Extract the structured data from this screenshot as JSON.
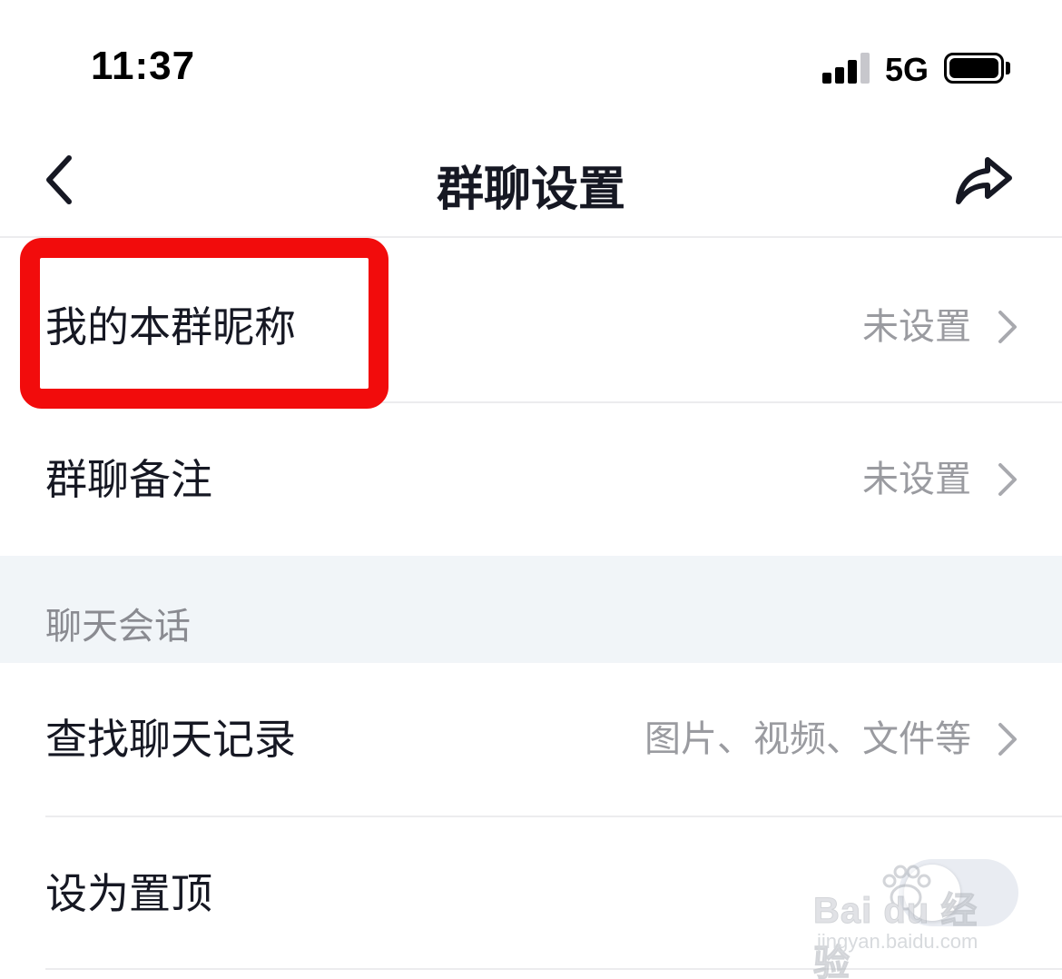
{
  "status_bar": {
    "time": "11:37",
    "network": "5G"
  },
  "nav": {
    "title": "群聊设置",
    "back_icon": "chevron-left-icon",
    "share_icon": "share-forward-icon"
  },
  "rows": {
    "group_nickname": {
      "label": "我的本群昵称",
      "value": "未设置"
    },
    "group_remark": {
      "label": "群聊备注",
      "value": "未设置"
    }
  },
  "section_chat": {
    "title": "聊天会话",
    "search_history": {
      "label": "查找聊天记录",
      "value": "图片、视频、文件等"
    },
    "pin_top": {
      "label": "设为置顶",
      "enabled": false
    }
  },
  "highlight_color": "#f20c0c",
  "watermark": {
    "main": "Bai du 经验",
    "sub": "jingyan.baidu.com"
  }
}
